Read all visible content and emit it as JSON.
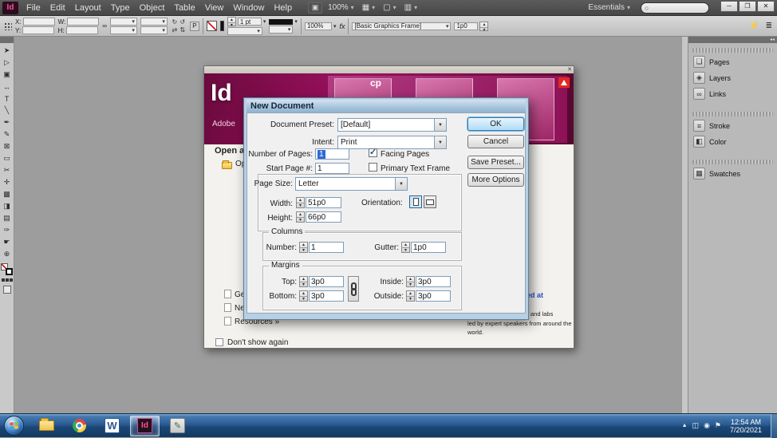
{
  "menubar": {
    "logo": "Id",
    "menus": [
      "File",
      "Edit",
      "Layout",
      "Type",
      "Object",
      "Table",
      "View",
      "Window",
      "Help"
    ],
    "bridge_icon": "▣",
    "zoom_value": "100%",
    "view_icons": [
      "▦",
      "▢",
      "▥"
    ],
    "workspace": "Essentials",
    "search_icon": "○",
    "window_controls": {
      "minimize": "─",
      "restore": "❐",
      "close": "✕"
    }
  },
  "controlbar": {
    "x_label": "X:",
    "y_label": "Y:",
    "w_label": "W:",
    "h_label": "H:",
    "chain_icon": "∞",
    "rotate_cw_icon": "↻",
    "rotate_ccw_icon": "↺",
    "flip_h_icon": "⇄",
    "flip_v_icon": "⇅",
    "select_content_icon": "P",
    "stroke_weight": "1 pt",
    "opacity": "100%",
    "fx_label": "fx",
    "object_style": "[Basic Graphics Frame]",
    "corner_size": "1p0",
    "quick_apply_icon": "⚡",
    "panel_menu_icon": "≣"
  },
  "toolbar": {
    "tools": [
      {
        "name": "selection-tool",
        "glyph": "➤"
      },
      {
        "name": "direct-selection-tool",
        "glyph": "▷"
      },
      {
        "name": "page-tool",
        "glyph": "▣"
      },
      {
        "name": "gap-tool",
        "glyph": "↔"
      },
      {
        "name": "type-tool",
        "glyph": "T"
      },
      {
        "name": "line-tool",
        "glyph": "╲"
      },
      {
        "name": "pen-tool",
        "glyph": "✒"
      },
      {
        "name": "pencil-tool",
        "glyph": "✎"
      },
      {
        "name": "frame-tool",
        "glyph": "⊠"
      },
      {
        "name": "rectangle-tool",
        "glyph": "▭"
      },
      {
        "name": "scissors-tool",
        "glyph": "✂"
      },
      {
        "name": "free-transform-tool",
        "glyph": "✛"
      },
      {
        "name": "gradient-tool",
        "glyph": "▩"
      },
      {
        "name": "gradient-feather-tool",
        "glyph": "◨"
      },
      {
        "name": "note-tool",
        "glyph": "▤"
      },
      {
        "name": "eyedropper-tool",
        "glyph": "✑"
      },
      {
        "name": "hand-tool",
        "glyph": "☛"
      },
      {
        "name": "zoom-tool",
        "glyph": "⊕"
      }
    ]
  },
  "panels": {
    "collapse_icon": "◂◂",
    "items": [
      {
        "glyph": "❏",
        "label": "Pages"
      },
      {
        "glyph": "◈",
        "label": "Layers"
      },
      {
        "glyph": "∞",
        "label": "Links"
      },
      {
        "glyph": "≡",
        "label": "Stroke"
      },
      {
        "glyph": "◧",
        "label": "Color"
      },
      {
        "glyph": "▦",
        "label": "Swatches"
      }
    ]
  },
  "welcome": {
    "close_icon": "✕",
    "logo": "Id",
    "brand": "Adobe",
    "cover_text": "cp",
    "heading": "Open a",
    "open_link": "Op",
    "footer_links": [
      "Ge",
      "Ne",
      "Resources »"
    ],
    "right_link": "ed at",
    "right_lines": [
      "and labs",
      "led by expert speakers from around the",
      "world."
    ],
    "dont_show": "Don't show again"
  },
  "dialog": {
    "title": "New Document",
    "preset_label": "Document Preset:",
    "preset_value": "[Default]",
    "intent_label": "Intent:",
    "intent_value": "Print",
    "num_pages_label": "Number of Pages:",
    "num_pages_value": "1",
    "facing_pages": "Facing Pages",
    "start_page_label": "Start Page #:",
    "start_page_value": "1",
    "primary_text_frame": "Primary Text Frame",
    "page_size_label": "Page Size:",
    "page_size_value": "Letter",
    "width_label": "Width:",
    "width_value": "51p0",
    "height_label": "Height:",
    "height_value": "66p0",
    "orientation_label": "Orientation:",
    "columns_legend": "Columns",
    "columns_number_label": "Number:",
    "columns_number_value": "1",
    "gutter_label": "Gutter:",
    "gutter_value": "1p0",
    "margins_legend": "Margins",
    "top_label": "Top:",
    "top_value": "3p0",
    "inside_label": "Inside:",
    "inside_value": "3p0",
    "bottom_label": "Bottom:",
    "bottom_value": "3p0",
    "outside_label": "Outside:",
    "outside_value": "3p0",
    "ok": "OK",
    "cancel": "Cancel",
    "save_preset": "Save Preset...",
    "more_options": "More Options"
  },
  "taskbar": {
    "word_label": "W",
    "indesign_label": "Id",
    "utility_glyph": "✎",
    "tray_icons": [
      "▲",
      "◫",
      "◉",
      "⚑"
    ],
    "clock_time": "12:54 AM",
    "clock_date": "7/20/2021"
  }
}
